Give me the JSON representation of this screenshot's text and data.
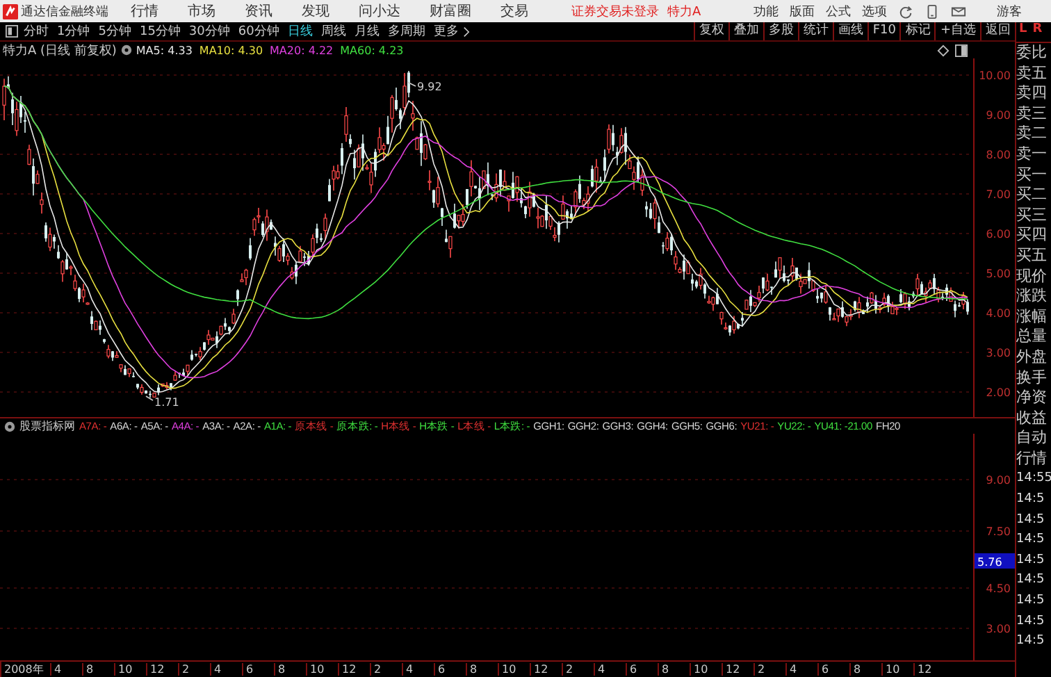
{
  "app": {
    "title": "通达信金融终端",
    "menu": [
      "行情",
      "市场",
      "资讯",
      "发现",
      "问小达",
      "财富圈",
      "交易"
    ],
    "login_status": "证券交易未登录",
    "stock": "特力A",
    "right_menu": [
      "功能",
      "版面",
      "公式",
      "选项"
    ],
    "user": "游客"
  },
  "periods": [
    {
      "label": "分时",
      "selected": false
    },
    {
      "label": "1分钟",
      "selected": false
    },
    {
      "label": "5分钟",
      "selected": false
    },
    {
      "label": "15分钟",
      "selected": false
    },
    {
      "label": "30分钟",
      "selected": false
    },
    {
      "label": "60分钟",
      "selected": false
    },
    {
      "label": "日线",
      "selected": true
    },
    {
      "label": "周线",
      "selected": false
    },
    {
      "label": "月线",
      "selected": false
    },
    {
      "label": "多周期",
      "selected": false
    },
    {
      "label": "更多",
      "selected": false
    }
  ],
  "tools": [
    "复权",
    "叠加",
    "多股",
    "统计",
    "画线",
    "F10",
    "标记",
    "+自选",
    "返回"
  ],
  "side_tabs": [
    "L",
    "R"
  ],
  "chart": {
    "title": "特力A (日线 前复权)",
    "ma": [
      {
        "label": "MA5: 4.33",
        "color": "#e8e8e8"
      },
      {
        "label": "MA10: 4.30",
        "color": "#e8e040"
      },
      {
        "label": "MA20: 4.22",
        "color": "#e040e0"
      },
      {
        "label": "MA60: 4.23",
        "color": "#40e040"
      }
    ],
    "price_labels": [
      "10.00",
      "9.00",
      "8.00",
      "7.00",
      "6.00",
      "5.00",
      "4.00",
      "3.00",
      "2.00"
    ],
    "high_mark": "9.92",
    "low_mark": "1.71"
  },
  "indicator": {
    "title": "股票指标网",
    "items": [
      {
        "text": "A7A: -",
        "color": "#e03030"
      },
      {
        "text": "A6A: -",
        "color": "#d8d8d8"
      },
      {
        "text": "A5A: -",
        "color": "#d8d8d8"
      },
      {
        "text": "A4A: -",
        "color": "#e040e0"
      },
      {
        "text": "A3A: -",
        "color": "#d8d8d8"
      },
      {
        "text": "A2A: -",
        "color": "#d8d8d8"
      },
      {
        "text": "A1A: -",
        "color": "#40e040"
      },
      {
        "text": "原本线 -",
        "color": "#e03030"
      },
      {
        "text": "原本跌: -",
        "color": "#40e040"
      },
      {
        "text": "H本线 -",
        "color": "#e03030"
      },
      {
        "text": "H本跌 -",
        "color": "#40e040"
      },
      {
        "text": "L本线 -",
        "color": "#e03030"
      },
      {
        "text": "L本跌: -",
        "color": "#40e040"
      },
      {
        "text": "GGH1:",
        "color": "#d8d8d8"
      },
      {
        "text": "GGH2:",
        "color": "#d8d8d8"
      },
      {
        "text": "GGH3:",
        "color": "#d8d8d8"
      },
      {
        "text": "GGH4:",
        "color": "#d8d8d8"
      },
      {
        "text": "GGH5:",
        "color": "#d8d8d8"
      },
      {
        "text": "GGH6:",
        "color": "#d8d8d8"
      },
      {
        "text": "YU21: -",
        "color": "#e03030"
      },
      {
        "text": "YU22: -",
        "color": "#40e040"
      },
      {
        "text": "YU41: -21.00",
        "color": "#40e040"
      },
      {
        "text": "FH20",
        "color": "#d8d8d8"
      }
    ],
    "axis_labels": [
      "9.00",
      "7.50",
      "4.50",
      "3.00"
    ],
    "current_value": "5.76"
  },
  "dates": [
    "2008年",
    "4",
    "8",
    "10",
    "12",
    "2",
    "4",
    "6",
    "8",
    "10",
    "12",
    "2",
    "4",
    "6",
    "8",
    "10",
    "12",
    "2",
    "4",
    "6",
    "8",
    "10",
    "12",
    "2",
    "4",
    "6",
    "8",
    "10",
    "12"
  ],
  "quote_panel": {
    "labels": [
      "委比",
      "卖五",
      "卖四",
      "卖三",
      "卖二",
      "卖一",
      "买一",
      "买二",
      "买三",
      "买四",
      "买五",
      "现价",
      "涨跌",
      "涨幅",
      "总量",
      "外盘",
      "换手",
      "净资",
      "收益",
      "自动",
      "行情"
    ],
    "times": [
      "14:55",
      "14:5",
      "14:5",
      "14:5",
      "14:5",
      "14:5",
      "14:5",
      "14:5",
      "14:5"
    ]
  }
}
